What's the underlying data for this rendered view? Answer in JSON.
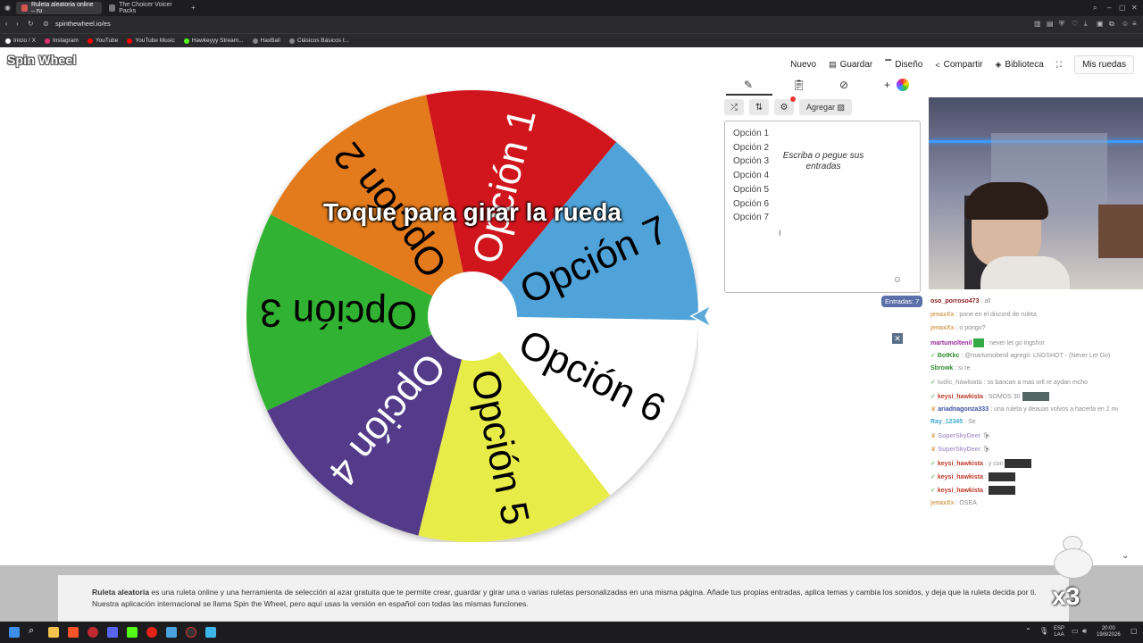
{
  "browser": {
    "tabs": [
      {
        "title": "Ruleta aleatoria online – ru",
        "active": true
      },
      {
        "title": "The Choicer Voicer Packs",
        "active": false
      }
    ],
    "url": "spinthewheel.io/es",
    "bookmarks": [
      {
        "label": "Inicio / X",
        "color": "#ffffff"
      },
      {
        "label": "Instagram",
        "color": "#e1306c"
      },
      {
        "label": "YouTube",
        "color": "#ff0000"
      },
      {
        "label": "YouTube Music",
        "color": "#ff0000"
      },
      {
        "label": "Hawkeyyy Stream...",
        "color": "#53fc18"
      },
      {
        "label": "HaxBall",
        "color": "#888888"
      },
      {
        "label": "Clásicos Básicos t...",
        "color": "#888888"
      }
    ]
  },
  "site": {
    "logo": "Spin Wheel",
    "nav": {
      "nuevo": "Nuevo",
      "guardar": "Guardar",
      "diseno": "Diseño",
      "compartir": "Compartir",
      "biblioteca": "Biblioteca",
      "mis_ruedas": "Mis ruedas"
    }
  },
  "wheel": {
    "cta": "Toque para girar la rueda",
    "segments": [
      {
        "label": "Opción 1",
        "color": "#d0161f",
        "text_color": "#ffffff"
      },
      {
        "label": "Opción 2",
        "color": "#e37a1b",
        "text_color": "#000000"
      },
      {
        "label": "Opción 3",
        "color": "#33b232",
        "text_color": "#000000"
      },
      {
        "label": "Opción 4",
        "color": "#533a8a",
        "text_color": "#ffffff"
      },
      {
        "label": "Opción 5",
        "color": "#e8ec48",
        "text_color": "#000000"
      },
      {
        "label": "Opción 6",
        "color": "#ffffff",
        "text_color": "#000000"
      },
      {
        "label": "Opción 7",
        "color": "#4fa3d8",
        "text_color": "#000000"
      }
    ],
    "pointer_color": "#5aa9d6"
  },
  "editor": {
    "add_label": "Agregar",
    "entries": [
      "Opción 1",
      "Opción 2",
      "Opción 3",
      "Opción 4",
      "Opción 5",
      "Opción 6",
      "Opción 7"
    ],
    "placeholder": "Escriba o pegue sus entradas",
    "count_label": "Entradas: 7"
  },
  "chat": [
    {
      "user": "oso_porroso473",
      "user_color": "#8b1a1a",
      "msg": ": all"
    },
    {
      "user": "jenaxXx",
      "user_color": "#d4a05a",
      "msg": ": pone en el discord de ruleta"
    },
    {
      "user": "jenaxXx",
      "user_color": "#d4a05a",
      "msg": ": o pongo?"
    },
    {
      "user": "martumoltenil",
      "user_color": "#9b2c9b",
      "msg": ": never let go ingshot"
    },
    {
      "user": "BotKkc",
      "user_color": "#2f8a2f",
      "msg": ": @martumoltenil agregó: LNGSHOT - (Never Let Go)"
    },
    {
      "user": "Sbrowk",
      "user_color": "#2f8a2f",
      "msg": ": si re"
    },
    {
      "user": "ludic_hawkiata",
      "user_color": "#b0b0b0",
      "msg": ": ss bancan a mas orll re aydan mcho"
    },
    {
      "user": "keysi_hawkista",
      "user_color": "#c0392b",
      "msg": ": SOMOS 30"
    },
    {
      "user": "ariadnagonza333",
      "user_color": "#3b4fa3",
      "msg": ": una ruleta y deauas volvos a hacerla en 2 mi"
    },
    {
      "user": "Ray_12345",
      "user_color": "#3da8c7",
      "msg": ": Se"
    },
    {
      "user": "SuperSkyDeer",
      "user_color": "#b0a0d0",
      "msg": ""
    },
    {
      "user": "SuperSkyDeer",
      "user_color": "#b0a0d0",
      "msg": ""
    },
    {
      "user": "keysi_hawkista",
      "user_color": "#c0392b",
      "msg": ": y con"
    },
    {
      "user": "keysi_hawkista",
      "user_color": "#c0392b",
      "msg": ":"
    },
    {
      "user": "keysi_hawkista",
      "user_color": "#c0392b",
      "msg": ":"
    },
    {
      "user": "jenaxXx",
      "user_color": "#d4a05a",
      "msg": ": OSEA"
    }
  ],
  "bottom": {
    "bold": "Ruleta aleatoria",
    "text": " es una ruleta online y una herramienta de selección al azar gratuita que te permite crear, guardar y girar una o varias ruletas personalizadas en una misma página. Añade tus propias entradas, aplica temas y cambia los sonidos, y deja que la ruleta decida por ti. Nuestra aplicación internacional se llama Spin the Wheel, pero aquí usas la versión en español con todas las mismas funciones.",
    "overlay_multiplier": "x3"
  },
  "taskbar": {
    "lang": "ESP",
    "lang2": "LAA",
    "time": "20:00",
    "date": "19/8/2026"
  }
}
